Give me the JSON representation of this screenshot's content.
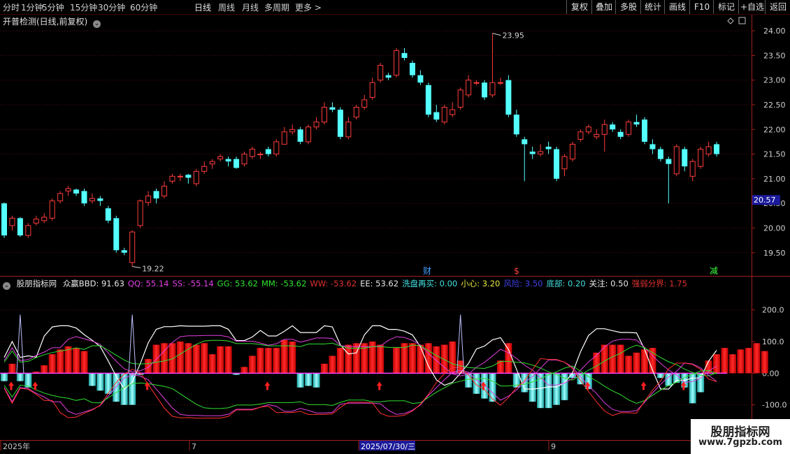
{
  "toolbar": {
    "periods": [
      "分时",
      "1分钟",
      "5分钟",
      "15分钟",
      "30分钟",
      "60分钟",
      "日线",
      "周线",
      "月线",
      "多周期",
      "更多 >"
    ],
    "active_period": "日线",
    "right_buttons": [
      "复权",
      "叠加",
      "多股",
      "统计",
      "画线",
      "F10",
      "标记",
      "+自选",
      "返回"
    ]
  },
  "price_panel": {
    "title": "开普检测(日线,前复权)",
    "high_label": "23.95",
    "low_label": "19.22",
    "current_price": "20.57",
    "event_markers": [
      "财",
      "$",
      "减"
    ],
    "y_ticks": [
      "24.00",
      "23.50",
      "23.00",
      "22.50",
      "22.00",
      "21.50",
      "21.00",
      "20.50",
      "20.00",
      "19.50"
    ]
  },
  "indicator_panel": {
    "name": "股朋指标网",
    "items": [
      {
        "label": "众赢BBD: 91.63",
        "color": "#e8e8e8"
      },
      {
        "label": "QQ: 55.14",
        "color": "#e040e0"
      },
      {
        "label": "SS: -55.14",
        "color": "#e040e0"
      },
      {
        "label": "GG: 53.62",
        "color": "#30e030"
      },
      {
        "label": "MM: -53.62",
        "color": "#30e030"
      },
      {
        "label": "WW: -53.62",
        "color": "#e03030"
      },
      {
        "label": "EE: 53.62",
        "color": "#e8e8e8"
      },
      {
        "label": "洗盘再买: 0.00",
        "color": "#40e0e0"
      },
      {
        "label": "小心: 3.20",
        "color": "#e8e840"
      },
      {
        "label": "风险: 3.50",
        "color": "#4040e8"
      },
      {
        "label": "底部: 0.20",
        "color": "#40e0e0"
      },
      {
        "label": "关注: 0.50",
        "color": "#e8e8e8"
      },
      {
        "label": "强弱分界: 1.75",
        "color": "#e03030"
      }
    ],
    "y_ticks": [
      "200.0",
      "100.0",
      "0.00",
      "-100.0"
    ]
  },
  "date_axis": {
    "labels": [
      "2025年",
      "7",
      "2025/07/30/三",
      "9"
    ]
  },
  "watermark": {
    "line1": "股朋指标网",
    "line2": "www.7gpzb.com"
  },
  "colors": {
    "up": "#ff3c3c",
    "down": "#54ffff",
    "grid": "#5a1010",
    "axis": "#a02020"
  },
  "chart_data": {
    "type": "candlestick",
    "candles": [
      [
        20.5,
        19.85,
        20.52,
        19.8
      ],
      [
        20.05,
        20.2,
        20.25,
        19.95
      ],
      [
        20.2,
        19.85,
        20.22,
        19.82
      ],
      [
        19.85,
        20.05,
        20.1,
        19.8
      ],
      [
        20.1,
        20.18,
        20.25,
        20.05
      ],
      [
        20.15,
        20.22,
        20.3,
        20.1
      ],
      [
        20.2,
        20.55,
        20.6,
        20.15
      ],
      [
        20.55,
        20.7,
        20.75,
        20.5
      ],
      [
        20.75,
        20.8,
        20.85,
        20.65
      ],
      [
        20.78,
        20.7,
        20.8,
        20.65
      ],
      [
        20.75,
        20.5,
        20.8,
        20.45
      ],
      [
        20.55,
        20.6,
        20.7,
        20.5
      ],
      [
        20.6,
        20.55,
        20.65,
        20.45
      ],
      [
        20.4,
        20.15,
        20.45,
        20.1
      ],
      [
        20.2,
        19.55,
        20.25,
        19.5
      ],
      [
        19.55,
        19.5,
        19.6,
        19.45
      ],
      [
        19.3,
        19.92,
        19.95,
        19.22
      ],
      [
        20.05,
        20.55,
        20.58,
        20.0
      ],
      [
        20.52,
        20.65,
        20.75,
        20.45
      ],
      [
        20.75,
        20.6,
        20.8,
        20.5
      ],
      [
        20.65,
        20.85,
        20.95,
        20.6
      ],
      [
        20.95,
        21.05,
        21.1,
        20.9
      ],
      [
        21.05,
        21.05,
        21.1,
        20.95
      ],
      [
        21.08,
        21.02,
        21.1,
        20.9
      ],
      [
        20.9,
        21.15,
        21.2,
        20.85
      ],
      [
        21.15,
        21.25,
        21.35,
        21.1
      ],
      [
        21.3,
        21.35,
        21.4,
        21.2
      ],
      [
        21.4,
        21.45,
        21.5,
        21.35
      ],
      [
        21.4,
        21.35,
        21.45,
        21.25
      ],
      [
        21.4,
        21.22,
        21.45,
        21.2
      ],
      [
        21.3,
        21.5,
        21.55,
        21.25
      ],
      [
        21.45,
        21.6,
        21.65,
        21.4
      ],
      [
        21.5,
        21.5,
        21.55,
        21.4
      ],
      [
        21.6,
        21.5,
        21.65,
        21.45
      ],
      [
        21.5,
        21.75,
        21.8,
        21.45
      ],
      [
        21.7,
        21.95,
        22.05,
        21.7
      ],
      [
        21.95,
        22.0,
        22.1,
        21.9
      ],
      [
        22.0,
        21.75,
        22.05,
        21.7
      ],
      [
        21.75,
        22.05,
        22.1,
        21.7
      ],
      [
        22.05,
        22.15,
        22.25,
        22.0
      ],
      [
        22.15,
        22.45,
        22.55,
        22.1
      ],
      [
        22.45,
        22.4,
        22.55,
        22.35
      ],
      [
        22.4,
        21.85,
        22.45,
        21.8
      ],
      [
        21.85,
        22.15,
        22.25,
        21.8
      ],
      [
        22.25,
        22.45,
        22.5,
        22.2
      ],
      [
        22.45,
        22.6,
        22.7,
        22.4
      ],
      [
        22.65,
        22.95,
        23.05,
        22.6
      ],
      [
        23.0,
        23.3,
        23.35,
        22.95
      ],
      [
        23.1,
        23.05,
        23.15,
        23.0
      ],
      [
        23.1,
        23.6,
        23.65,
        23.05
      ],
      [
        23.55,
        23.45,
        23.65,
        23.4
      ],
      [
        23.35,
        23.1,
        23.4,
        23.05
      ],
      [
        23.1,
        22.95,
        23.2,
        22.9
      ],
      [
        22.9,
        22.3,
        22.95,
        22.25
      ],
      [
        22.35,
        22.2,
        22.5,
        22.15
      ],
      [
        22.15,
        22.45,
        22.5,
        22.1
      ],
      [
        22.3,
        22.4,
        22.55,
        22.25
      ],
      [
        22.45,
        22.8,
        22.85,
        22.4
      ],
      [
        22.7,
        23.0,
        23.1,
        22.65
      ],
      [
        22.95,
        22.95,
        23.0,
        22.9
      ],
      [
        22.95,
        22.65,
        23.0,
        22.6
      ],
      [
        22.7,
        22.95,
        23.95,
        22.65
      ],
      [
        22.95,
        22.95,
        23.05,
        22.9
      ],
      [
        23.0,
        22.3,
        23.1,
        22.25
      ],
      [
        22.3,
        21.9,
        22.4,
        21.85
      ],
      [
        21.8,
        21.7,
        21.85,
        20.95
      ],
      [
        21.55,
        21.5,
        21.65,
        21.4
      ],
      [
        21.5,
        21.55,
        21.7,
        21.45
      ],
      [
        21.65,
        21.6,
        21.75,
        21.5
      ],
      [
        21.6,
        21.0,
        21.65,
        20.95
      ],
      [
        21.2,
        21.45,
        21.5,
        21.05
      ],
      [
        21.4,
        21.7,
        21.75,
        21.35
      ],
      [
        21.8,
        21.95,
        22.0,
        21.75
      ],
      [
        21.95,
        22.05,
        22.1,
        21.9
      ],
      [
        21.85,
        21.9,
        22.0,
        21.8
      ],
      [
        21.9,
        22.1,
        22.2,
        21.55
      ],
      [
        22.1,
        22.0,
        22.15,
        21.95
      ],
      [
        21.95,
        21.85,
        22.0,
        21.8
      ],
      [
        21.9,
        22.15,
        22.2,
        21.85
      ],
      [
        22.15,
        22.1,
        22.3,
        22.05
      ],
      [
        22.2,
        21.75,
        22.25,
        21.7
      ],
      [
        21.7,
        21.6,
        21.8,
        21.5
      ],
      [
        21.6,
        21.4,
        21.65,
        21.35
      ],
      [
        21.4,
        21.3,
        21.45,
        20.5
      ],
      [
        21.1,
        21.65,
        21.7,
        21.05
      ],
      [
        21.6,
        21.25,
        21.65,
        21.15
      ],
      [
        21.05,
        21.35,
        21.4,
        20.95
      ],
      [
        21.25,
        21.6,
        21.65,
        21.2
      ],
      [
        21.5,
        21.65,
        21.75,
        21.45
      ],
      [
        21.7,
        21.5,
        21.75,
        21.45
      ]
    ],
    "indicator_bars": [
      -25,
      30,
      -25,
      -45,
      5,
      25,
      60,
      75,
      85,
      80,
      70,
      -40,
      -55,
      -65,
      -90,
      -100,
      -100,
      -5,
      45,
      90,
      95,
      95,
      100,
      95,
      90,
      95,
      60,
      85,
      85,
      -5,
      20,
      55,
      80,
      80,
      80,
      105,
      100,
      -45,
      -40,
      -45,
      30,
      55,
      80,
      90,
      95,
      95,
      100,
      90,
      0,
      80,
      95,
      95,
      90,
      95,
      85,
      90,
      100,
      40,
      -45,
      -65,
      -80,
      -90,
      40,
      95,
      -45,
      -60,
      -90,
      -110,
      -110,
      -100,
      -85,
      -15,
      -35,
      -50,
      65,
      90,
      90,
      90,
      55,
      65,
      75,
      80,
      -15,
      -40,
      -30,
      -45,
      -95,
      -60,
      40,
      60,
      80,
      60,
      75,
      80,
      95,
      70
    ],
    "y_range_price": [
      19.1,
      24.2
    ],
    "y_range_indicator": [
      -200,
      270
    ]
  }
}
